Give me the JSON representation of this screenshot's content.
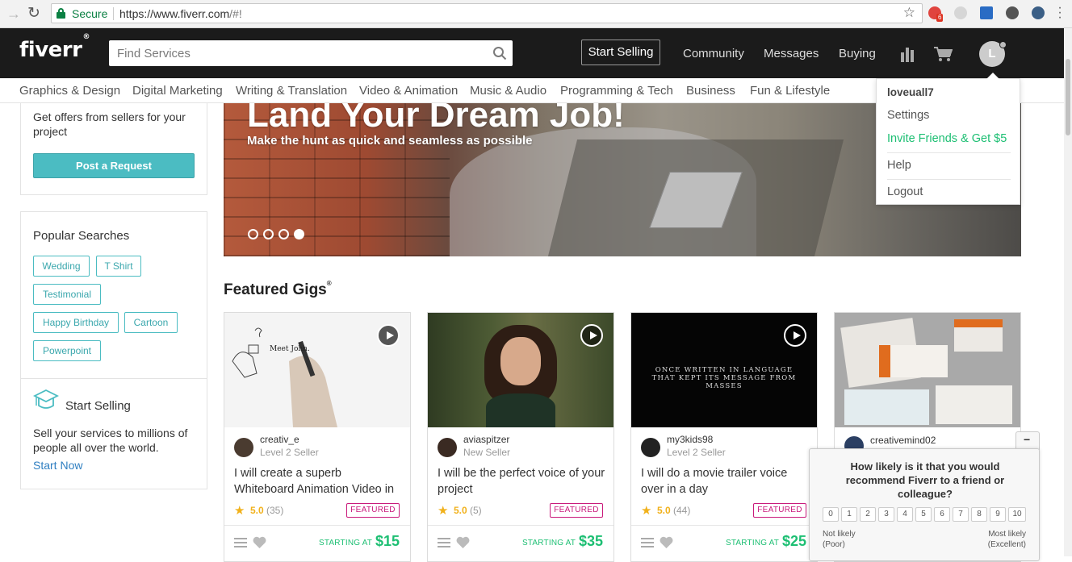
{
  "browser": {
    "secure_label": "Secure",
    "url_main": "https://www.fiverr.com",
    "url_rest": "/#!",
    "ext_badge": "6"
  },
  "header": {
    "logo": "fiverr",
    "logo_mark": "®",
    "search_placeholder": "Find Services",
    "start_selling": "Start Selling",
    "nav": [
      "Community",
      "Messages",
      "Buying"
    ],
    "avatar_initial": "L"
  },
  "categories": [
    "Graphics & Design",
    "Digital Marketing",
    "Writing & Translation",
    "Video & Animation",
    "Music & Audio",
    "Programming & Tech",
    "Business",
    "Fun & Lifestyle"
  ],
  "sidebar": {
    "offers_text": "Get offers from sellers for your project",
    "post_request": "Post a Request",
    "popular_title": "Popular Searches",
    "tags": [
      "Wedding",
      "T Shirt",
      "Testimonial",
      "Happy Birthday",
      "Cartoon",
      "Powerpoint"
    ],
    "start_selling_title": "Start Selling",
    "start_selling_text": "Sell your services to millions of people all over the world.",
    "start_now": "Start Now"
  },
  "hero": {
    "title": "Land Your Dream Job!",
    "subtitle": "Make the hunt as quick and seamless as possible",
    "active_slide": 4,
    "slide_count": 4
  },
  "featured": {
    "title": "Featured Gigs",
    "title_mark": "®",
    "starting_at": "STARTING AT",
    "badge": "FEATURED",
    "gigs": [
      {
        "seller": "creativ_e",
        "level": "Level 2 Seller",
        "desc": "I will create a superb Whiteboard Animation Video in",
        "rating": "5.0",
        "count": "(35)",
        "price": "$15",
        "thumb_caption": "Meet John."
      },
      {
        "seller": "aviaspitzer",
        "level": "New Seller",
        "desc": "I will be the perfect voice of your project",
        "rating": "5.0",
        "count": "(5)",
        "price": "$35"
      },
      {
        "seller": "my3kids98",
        "level": "Level 2 Seller",
        "desc": "I will do a movie trailer voice over in a day",
        "rating": "5.0",
        "count": "(44)",
        "price": "$25",
        "thumb_caption": "ONCE WRITTEN IN LANGUAGE THAT KEPT ITS MESSAGE FROM MASSES"
      },
      {
        "seller": "creativemind02"
      }
    ]
  },
  "dropdown": {
    "username": "loveuall7",
    "settings": "Settings",
    "invite": "Invite Friends & Get $5",
    "help": "Help",
    "logout": "Logout"
  },
  "survey": {
    "minimize": "−",
    "question": "How likely is it that you would recommend Fiverr to a friend or colleague?",
    "scale": [
      "0",
      "1",
      "2",
      "3",
      "4",
      "5",
      "6",
      "7",
      "8",
      "9",
      "10"
    ],
    "low_label": "Not likely",
    "low_sub": "(Poor)",
    "high_label": "Most likely",
    "high_sub": "(Excellent)"
  },
  "colors": {
    "brand_green": "#1dbf73",
    "teal": "#4bbcc2",
    "featured_pink": "#c9197b",
    "header_bg": "#1b1b1b"
  }
}
